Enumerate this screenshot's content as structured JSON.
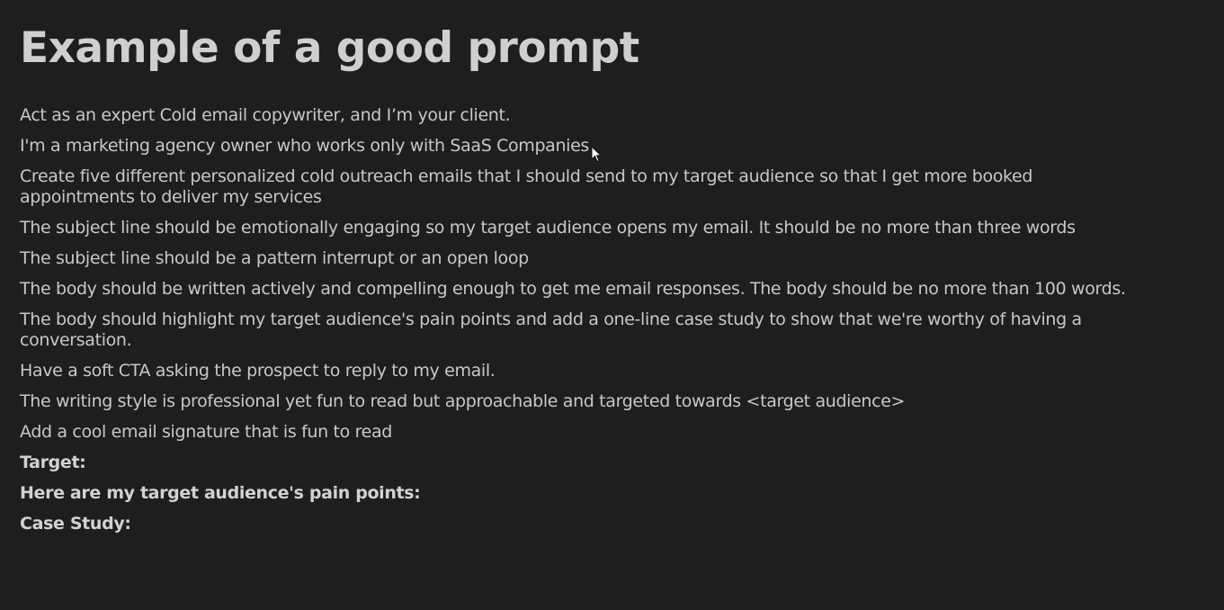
{
  "title": "Example of a good prompt",
  "lines": [
    "Act as an expert Cold email copywriter, and I’m your client.",
    "I'm a marketing agency owner who works only with SaaS Companies",
    "Create five different personalized cold outreach emails that I should send to my target audience so that I get more booked appointments to deliver my services",
    "The subject line should be emotionally engaging so my target audience opens my email. It should be no more than three words",
    "The subject line should be a pattern interrupt or an open loop",
    "The body should be written actively and compelling enough to get me email responses. The body should be no more than 100 words.",
    "The body should highlight my target audience's pain points and add a one-line case study to show that we're worthy of having a conversation.",
    "Have a soft CTA asking the prospect to reply to my email.",
    "The writing style is professional yet fun to read but approachable and targeted towards <target audience>",
    "Add a cool email signature that is fun to read"
  ],
  "fields": [
    "Target:",
    "Here are my target audience's pain points:",
    "Case Study:"
  ]
}
